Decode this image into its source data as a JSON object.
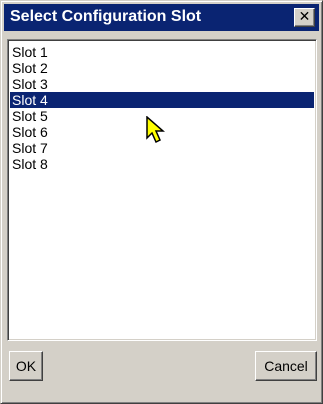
{
  "dialog": {
    "title": "Select Configuration Slot",
    "close_label": "✕"
  },
  "slots": {
    "items": [
      "Slot 1",
      "Slot 2",
      "Slot 3",
      "Slot 4",
      "Slot 5",
      "Slot 6",
      "Slot 7",
      "Slot 8"
    ],
    "selected_index": 3
  },
  "buttons": {
    "ok_label": "OK",
    "cancel_label": "Cancel"
  },
  "colors": {
    "titlebar": "#0a2472",
    "selection": "#0a2472",
    "window": "#d4d0c8",
    "cursor": "#ffff00"
  },
  "icons": {
    "cursor": "arrow-cursor-icon"
  }
}
